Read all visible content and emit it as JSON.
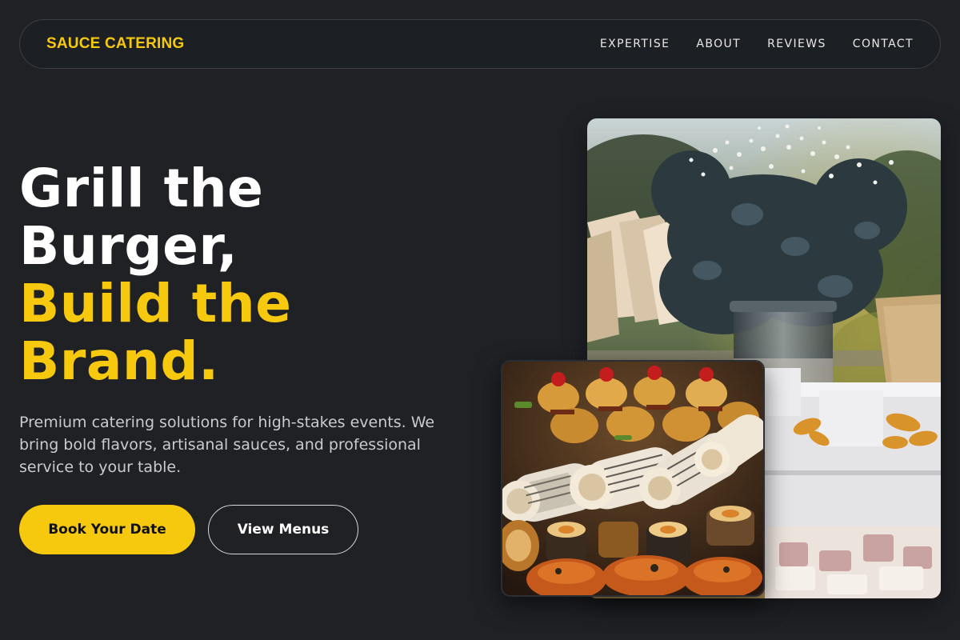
{
  "nav": {
    "logo": "SAUCE CATERING",
    "links": [
      "EXPERTISE",
      "ABOUT",
      "REVIEWS",
      "CONTACT"
    ]
  },
  "hero": {
    "headline_line1": "Grill the",
    "headline_line2": "Burger,",
    "headline_line3": "Build the",
    "headline_line4": "Brand.",
    "subtitle": "Premium catering solutions for high-stakes events. We bring bold flavors, artisanal sauces, and professional service to your table.",
    "primary_button": "Book Your Date",
    "secondary_button": "View Menus"
  },
  "images": {
    "large": "catering-table-photo",
    "small": "appetizers-photo"
  },
  "colors": {
    "background": "#1f2125",
    "accent": "#f6c90e",
    "text": "#ffffff",
    "muted": "#c9cbcf"
  }
}
